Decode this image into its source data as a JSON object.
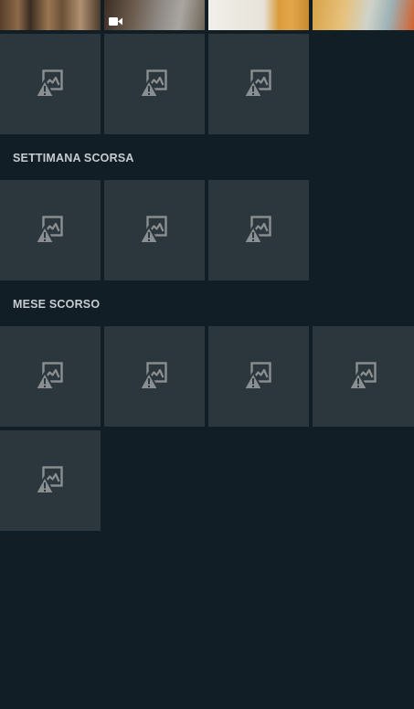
{
  "sections": [
    {
      "title": ""
    },
    {
      "title": "SETTIMANA SCORSA"
    },
    {
      "title": "MESE SCORSO"
    }
  ],
  "icons": {
    "placeholder": "broken-image-icon",
    "video": "video-camera-icon"
  },
  "colors": {
    "background": "#121e26",
    "tile": "#2c363d",
    "icon": "#8a8f92",
    "header_text": "#c7ccd0"
  }
}
